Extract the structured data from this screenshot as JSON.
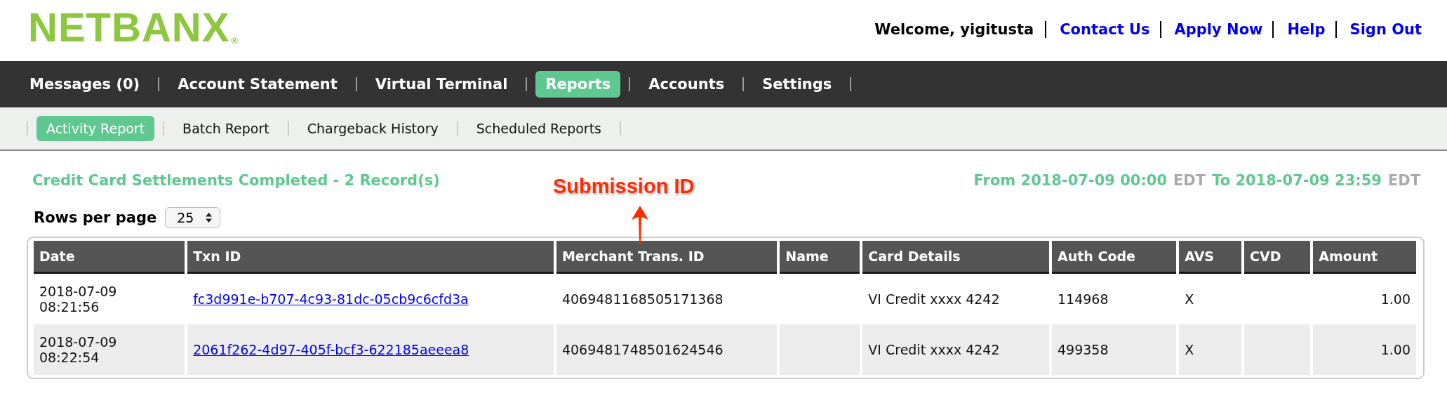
{
  "logo": {
    "text": "NETBANX",
    "mark": "®"
  },
  "header": {
    "welcome": "Welcome, yigitusta",
    "links": [
      "Contact Us",
      "Apply Now",
      "Help",
      "Sign Out"
    ]
  },
  "nav": [
    {
      "label": "Messages (0)",
      "selected": false
    },
    {
      "label": "Account Statement",
      "selected": false
    },
    {
      "label": "Virtual Terminal",
      "selected": false
    },
    {
      "label": "Reports",
      "selected": true
    },
    {
      "label": "Accounts",
      "selected": false
    },
    {
      "label": "Settings",
      "selected": false
    }
  ],
  "subnav": [
    {
      "label": "Activity Report",
      "selected": true
    },
    {
      "label": "Batch Report",
      "selected": false
    },
    {
      "label": "Chargeback History",
      "selected": false
    },
    {
      "label": "Scheduled Reports",
      "selected": false
    }
  ],
  "report": {
    "title": "Credit Card Settlements Completed - 2 Record(s)",
    "range": [
      {
        "text": "From 2018-07-09 00:00",
        "kind": "value"
      },
      {
        "text": "EDT",
        "kind": "zone"
      },
      {
        "text": "To 2018-07-09 23:59",
        "kind": "value"
      },
      {
        "text": "EDT",
        "kind": "zone"
      }
    ],
    "rows_per_page": {
      "label": "Rows per page",
      "value": "25"
    }
  },
  "annotation": {
    "text": "Submission ID"
  },
  "table": {
    "columns": [
      {
        "label": "Date",
        "kind": "date"
      },
      {
        "label": "Txn ID",
        "kind": "link"
      },
      {
        "label": "Merchant Trans. ID",
        "kind": "text"
      },
      {
        "label": "Name",
        "kind": "text"
      },
      {
        "label": "Card Details",
        "kind": "text"
      },
      {
        "label": "Auth Code",
        "kind": "text"
      },
      {
        "label": "AVS",
        "kind": "text"
      },
      {
        "label": "CVD",
        "kind": "text"
      },
      {
        "label": "Amount",
        "kind": "number"
      }
    ],
    "rows": [
      [
        "2018-07-09 08:21:56",
        "fc3d991e-b707-4c93-81dc-05cb9c6cfd3a",
        "4069481168505171368",
        "",
        "VI Credit xxxx 4242",
        "114968",
        "X",
        "",
        "1.00"
      ],
      [
        "2018-07-09 08:22:54",
        "2061f262-4d97-405f-bcf3-622185aeeea8",
        "4069481748501624546",
        "",
        "VI Credit xxxx 4242",
        "499358",
        "X",
        "",
        "1.00"
      ]
    ]
  }
}
